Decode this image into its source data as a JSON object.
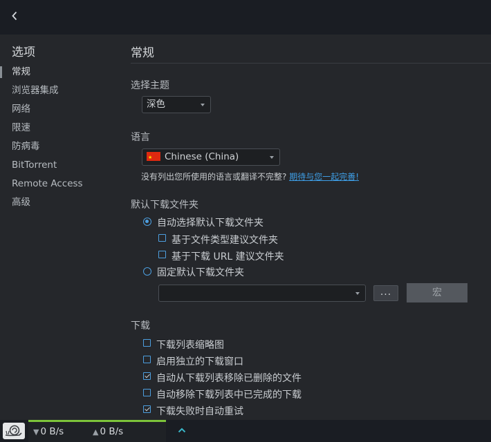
{
  "topbar": {
    "back_icon": "chevron-left-icon"
  },
  "sidebar": {
    "title": "选项",
    "items": [
      {
        "label": "常规",
        "active": true
      },
      {
        "label": "浏览器集成",
        "active": false
      },
      {
        "label": "网络",
        "active": false
      },
      {
        "label": "限速",
        "active": false
      },
      {
        "label": "防病毒",
        "active": false
      },
      {
        "label": "BitTorrent",
        "active": false
      },
      {
        "label": "Remote Access",
        "active": false
      },
      {
        "label": "高级",
        "active": false
      }
    ]
  },
  "main": {
    "title": "常规",
    "theme": {
      "label": "选择主题",
      "value": "深色"
    },
    "language": {
      "label": "语言",
      "value": "Chinese (China)",
      "flag": "china-flag-icon",
      "note": "没有列出您所使用的语言或翻译不完整?",
      "link": "期待与您一起完善!"
    },
    "download_folder": {
      "label": "默认下载文件夹",
      "auto_option": {
        "label": "自动选择默认下载文件夹",
        "selected": true
      },
      "by_type": {
        "label": "基于文件类型建议文件夹",
        "checked": false
      },
      "by_url": {
        "label": "基于下载 URL 建议文件夹",
        "checked": false
      },
      "fixed_option": {
        "label": "固定默认下载文件夹",
        "selected": false
      },
      "path_value": "",
      "browse_label": "...",
      "macro_label": "宏"
    },
    "downloads": {
      "label": "下载",
      "options": [
        {
          "label": "下载列表缩略图",
          "checked": false
        },
        {
          "label": "启用独立的下载窗口",
          "checked": false
        },
        {
          "label": "自动从下载列表移除已删除的文件",
          "checked": true
        },
        {
          "label": "自动移除下载列表中已完成的下载",
          "checked": false
        },
        {
          "label": "下载失败时自动重试",
          "checked": true
        }
      ]
    }
  },
  "statusbar": {
    "snail_icon": "snail-icon",
    "down_speed": "0 B/s",
    "up_speed": "0 B/s",
    "accent": "#7dc43a",
    "toggle_icon": "chevron-up-icon"
  },
  "colors": {
    "link": "#3e9ee6",
    "control_accent": "#4d9fe0"
  }
}
